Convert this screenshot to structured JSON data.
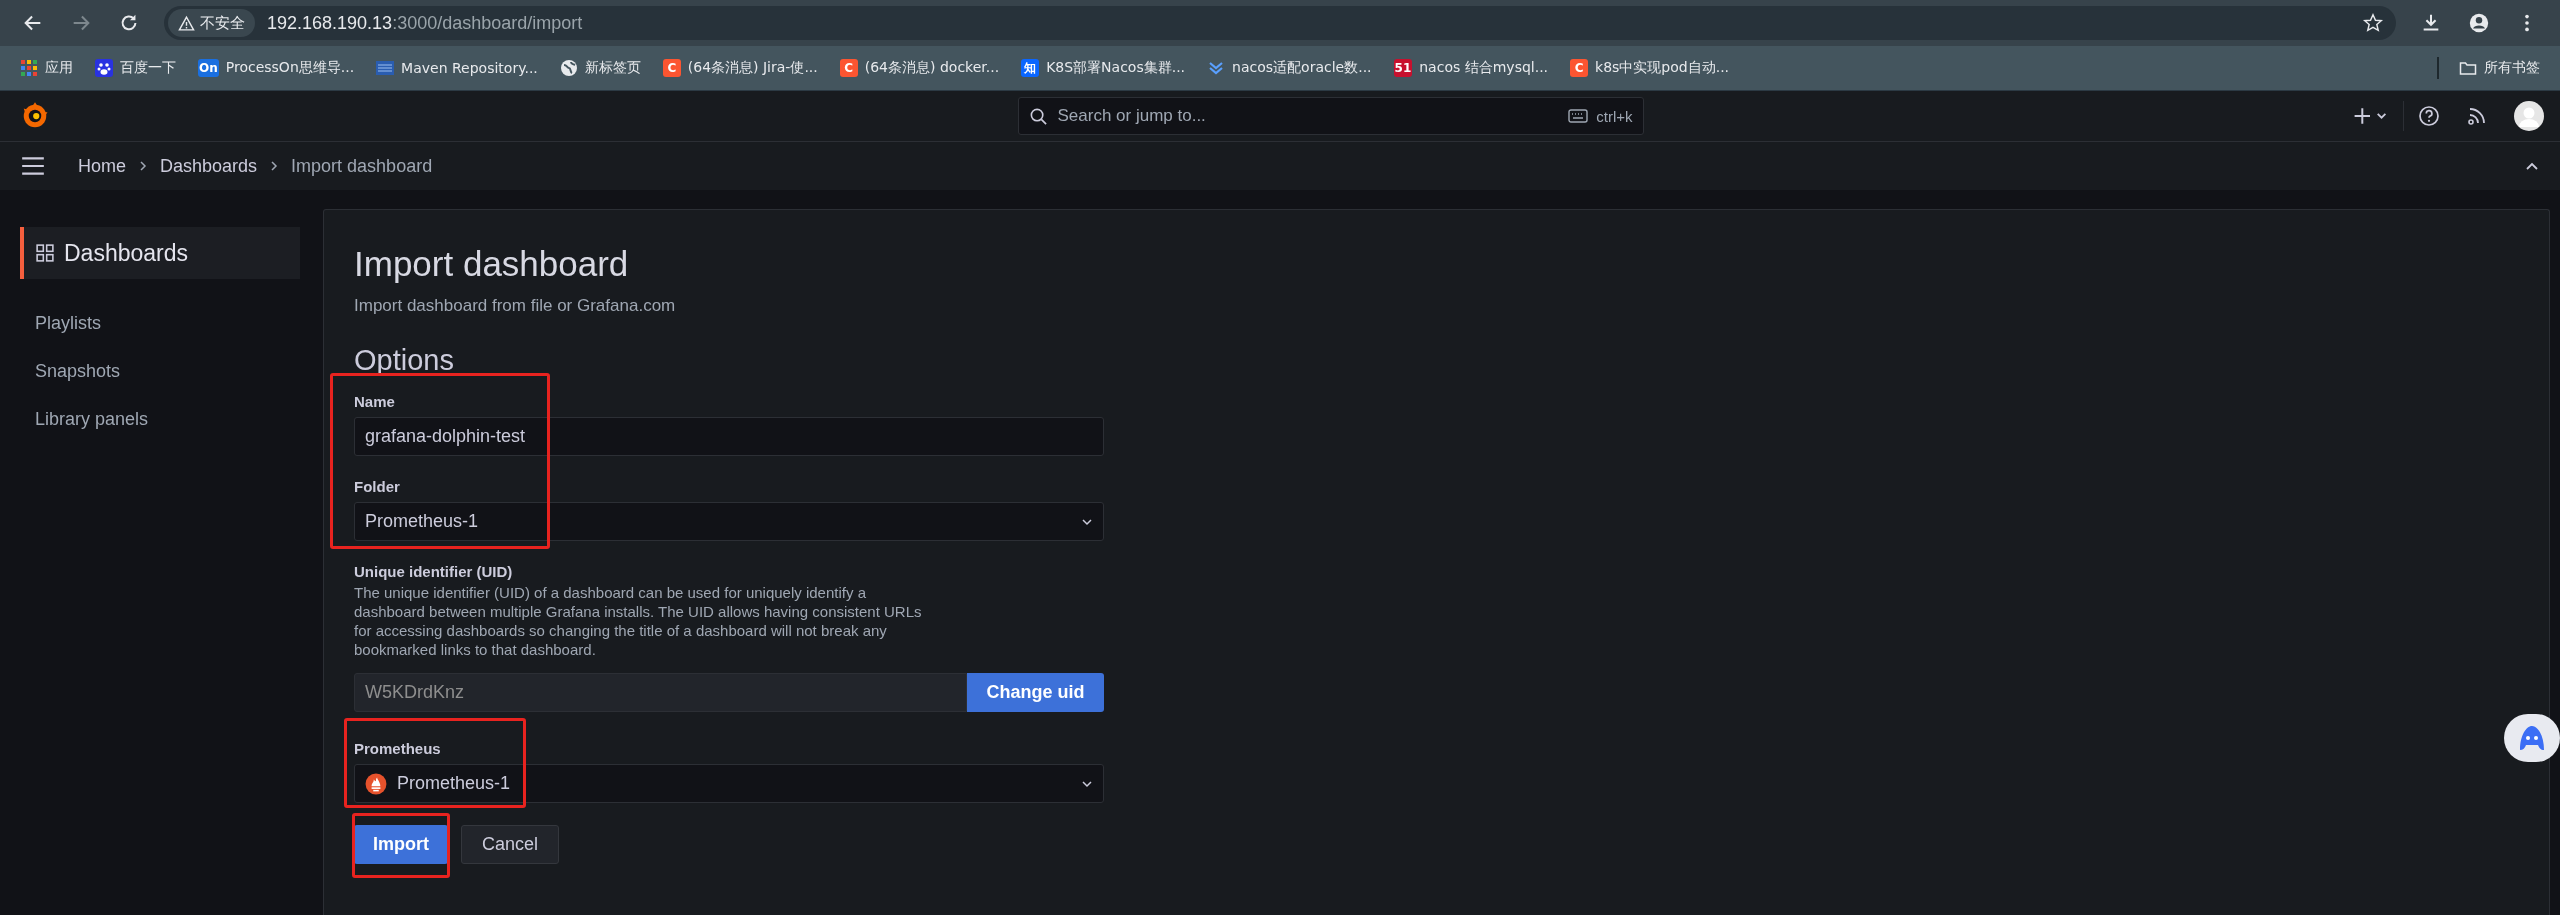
{
  "browser": {
    "security_label": "不安全",
    "url_host": "192.168.190.13",
    "url_path": ":3000/dashboard/import",
    "bookmarks": [
      {
        "label": "应用",
        "kind": "apps"
      },
      {
        "label": "百度一下",
        "kind": "paw"
      },
      {
        "label": "ProcessOn思维导...",
        "kind": "glyph",
        "icon_text": "On",
        "color": "#1a6fe0"
      },
      {
        "label": "Maven Repository...",
        "kind": "maven"
      },
      {
        "label": "新标签页",
        "kind": "globe"
      },
      {
        "label": "(64条消息) Jira-使...",
        "kind": "glyph",
        "icon_text": "C",
        "color": "#fc5531"
      },
      {
        "label": "(64条消息) docker...",
        "kind": "glyph",
        "icon_text": "C",
        "color": "#fc5531"
      },
      {
        "label": "K8S部署Nacos集群...",
        "kind": "glyph",
        "icon_text": "知",
        "color": "#0a66ff"
      },
      {
        "label": "nacos适配oracle数...",
        "kind": "chevrons"
      },
      {
        "label": "nacos 结合mysql...",
        "kind": "glyph",
        "icon_text": "51",
        "color": "#c8102e"
      },
      {
        "label": "k8s中实现pod自动...",
        "kind": "glyph",
        "icon_text": "C",
        "color": "#fc5531"
      }
    ],
    "all_bookmarks": "所有书签"
  },
  "top_bar": {
    "search_placeholder": "Search or jump to...",
    "shortcut": "ctrl+k"
  },
  "breadcrumbs": [
    {
      "label": "Home",
      "current": false
    },
    {
      "label": "Dashboards",
      "current": false
    },
    {
      "label": "Import dashboard",
      "current": true
    }
  ],
  "sidebar": {
    "items": [
      {
        "label": "Dashboards",
        "kind": "section",
        "selected": true
      },
      {
        "label": "Playlists",
        "kind": "link",
        "selected": false
      },
      {
        "label": "Snapshots",
        "kind": "link",
        "selected": false
      },
      {
        "label": "Library panels",
        "kind": "link",
        "selected": false
      }
    ]
  },
  "form": {
    "title": "Import dashboard",
    "subtitle": "Import dashboard from file or Grafana.com",
    "options_heading": "Options",
    "name": {
      "label": "Name",
      "value": "grafana-dolphin-test"
    },
    "folder": {
      "label": "Folder",
      "value": "Prometheus-1"
    },
    "uid": {
      "label": "Unique identifier (UID)",
      "description": "The unique identifier (UID) of a dashboard can be used for uniquely identify a dashboard between multiple Grafana installs. The UID allows having consistent URLs for accessing dashboards so changing the title of a dashboard will not break any bookmarked links to that dashboard.",
      "value": "W5KDrdKnz",
      "button": "Change uid"
    },
    "datasource": {
      "label": "Prometheus",
      "value": "Prometheus-1"
    },
    "buttons": [
      {
        "label": "Import",
        "kind": "primary"
      },
      {
        "label": "Cancel",
        "kind": "secondary"
      }
    ]
  }
}
